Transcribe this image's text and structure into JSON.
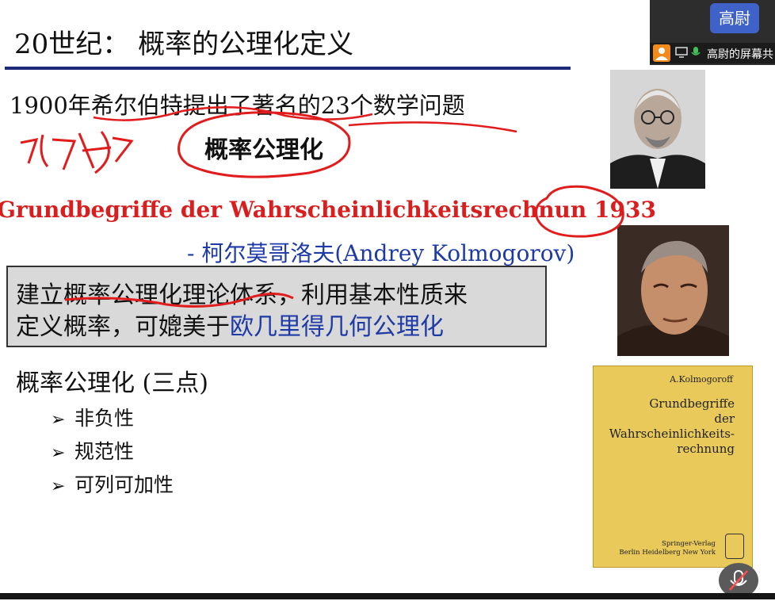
{
  "slide": {
    "title": "20世纪：  概率的公理化定义",
    "line1": "1900年希尔伯特提出了著名的23个数学问题",
    "handwritten_note": "概率公理化",
    "book_line": "Grundbegriffe der Wahrscheinlichkeitsrechnun 1933",
    "author_line": "- 柯尔莫哥洛夫(Andrey Kolmogorov)",
    "box_line1": "建立概率公理化理论体系，利用基本性质来",
    "box_line2_prefix": "定义概率，可媲美于",
    "box_line2_highlight": "欧几里得几何公理化",
    "subheading": "概率公理化  (三点)",
    "bullets": [
      "非负性",
      "规范性",
      "可列可加性"
    ],
    "bullet_arrow": "➢"
  },
  "book_cover": {
    "author": "A.Kolmogoroff",
    "title_lines": [
      "Grundbegriffe",
      "der",
      "Wahrscheinlichkeits-",
      "rechnung"
    ],
    "publisher_line1": "Springer-Verlag",
    "publisher_line2": "Berlin  Heidelberg  New York"
  },
  "meeting": {
    "presenter_name": "高尉",
    "share_label": "高尉的屏幕共"
  },
  "colors": {
    "accent_red": "#d81e1e",
    "accent_blue": "#1d3aa6",
    "title_rule": "#1d2a7a",
    "box_bg": "#d9d9d9",
    "book_cover": "#e8c95a",
    "zoom_tile": "#3e62c8"
  },
  "icons": {
    "avatar": "person-icon",
    "share": "screen-share-icon",
    "mic": "microphone-icon",
    "mute": "microphone-muted-icon"
  }
}
